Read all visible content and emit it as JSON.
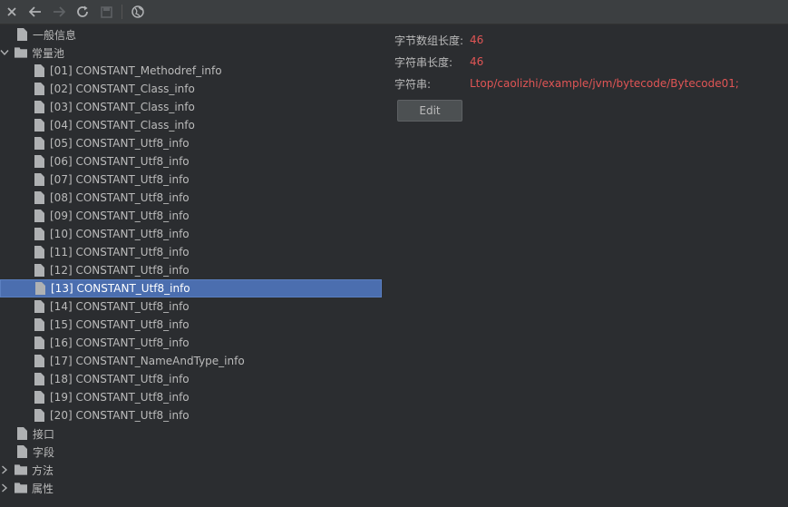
{
  "toolbar": {
    "icons": [
      "close-icon",
      "back-icon",
      "forward-icon",
      "refresh-icon",
      "save-icon",
      "globe-icon"
    ]
  },
  "tree": {
    "general": "一般信息",
    "constant_pool": "常量池",
    "constants": [
      "[01] CONSTANT_Methodref_info",
      "[02] CONSTANT_Class_info",
      "[03] CONSTANT_Class_info",
      "[04] CONSTANT_Class_info",
      "[05] CONSTANT_Utf8_info",
      "[06] CONSTANT_Utf8_info",
      "[07] CONSTANT_Utf8_info",
      "[08] CONSTANT_Utf8_info",
      "[09] CONSTANT_Utf8_info",
      "[10] CONSTANT_Utf8_info",
      "[11] CONSTANT_Utf8_info",
      "[12] CONSTANT_Utf8_info",
      "[13] CONSTANT_Utf8_info",
      "[14] CONSTANT_Utf8_info",
      "[15] CONSTANT_Utf8_info",
      "[16] CONSTANT_Utf8_info",
      "[17] CONSTANT_NameAndType_info",
      "[18] CONSTANT_Utf8_info",
      "[19] CONSTANT_Utf8_info",
      "[20] CONSTANT_Utf8_info"
    ],
    "selected_index": 12,
    "interfaces": "接口",
    "fields": "字段",
    "methods": "方法",
    "attributes": "属性"
  },
  "detail": {
    "byte_len_label": "字节数组长度:",
    "byte_len_value": "46",
    "str_len_label": "字符串长度:",
    "str_len_value": "46",
    "string_label": "字符串:",
    "string_value": "Ltop/caolizhi/example/jvm/bytecode/Bytecode01;",
    "edit_label": "Edit"
  }
}
